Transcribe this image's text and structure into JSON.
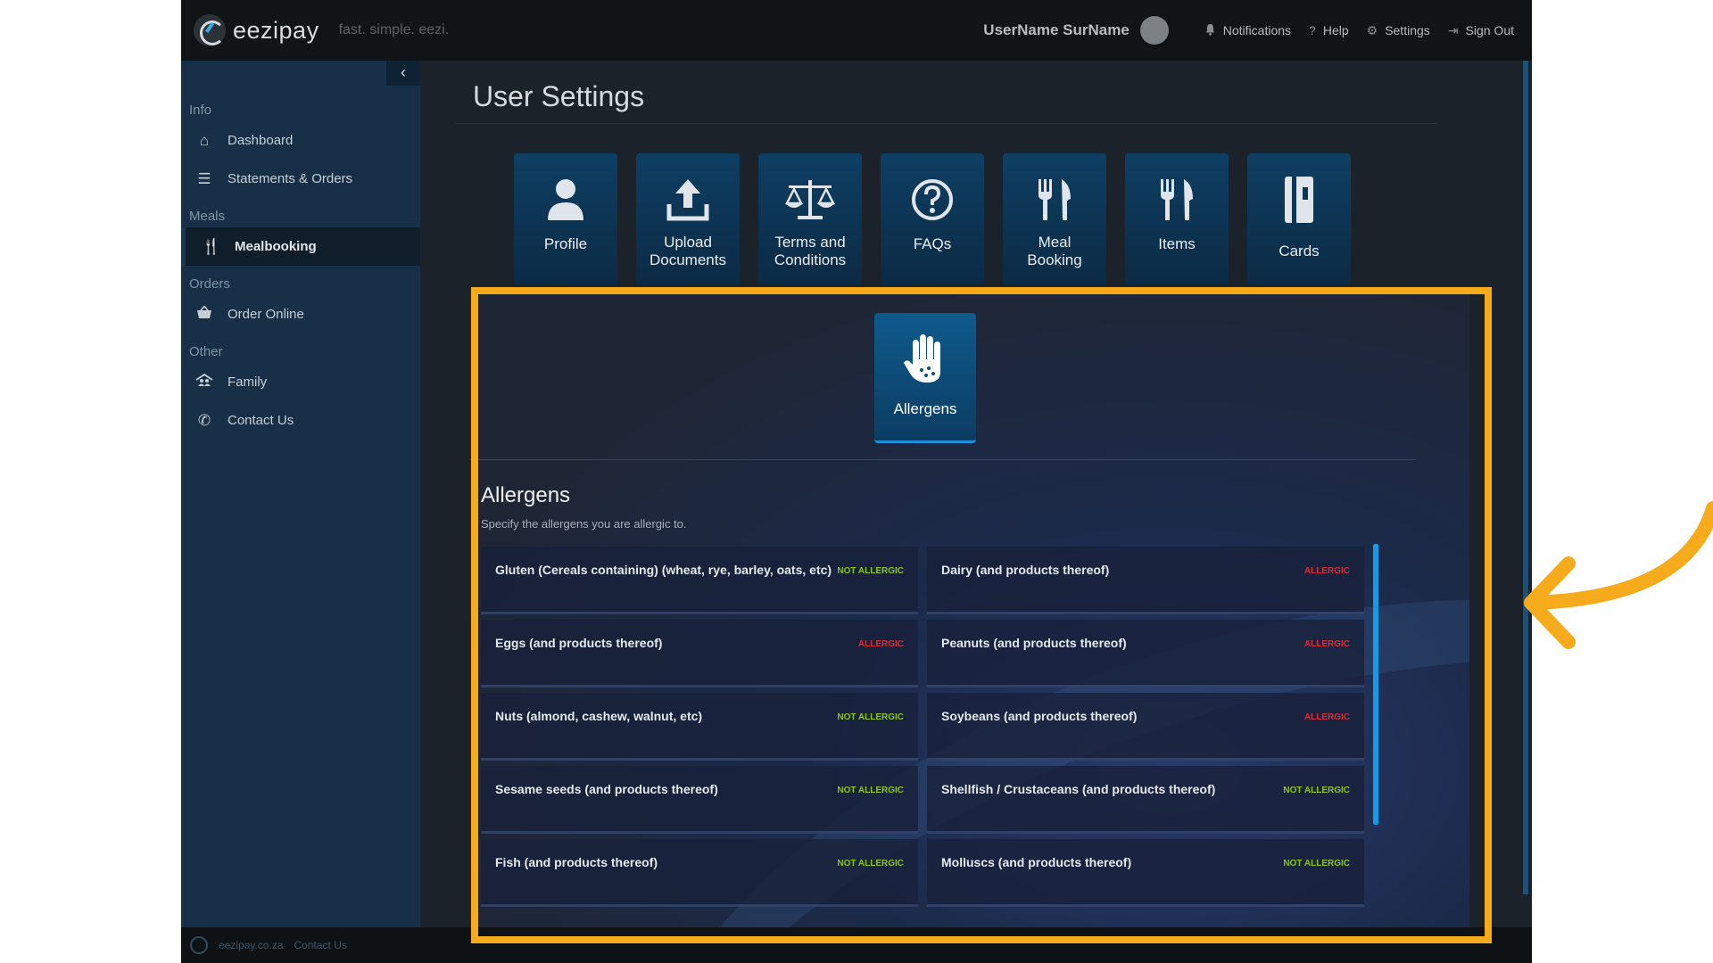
{
  "header": {
    "logo_text": "eezipay",
    "tagline": "fast. simple. eezi.",
    "username": "UserName SurName",
    "nav": [
      {
        "label": "Notifications",
        "icon": "bell-icon"
      },
      {
        "label": "Help",
        "icon": "question-icon"
      },
      {
        "label": "Settings",
        "icon": "gear-icon"
      },
      {
        "label": "Sign Out",
        "icon": "sign-out-icon"
      }
    ]
  },
  "sidebar": {
    "collapse_glyph": "‹",
    "sections": [
      {
        "title": "Info",
        "items": [
          {
            "label": "Dashboard",
            "icon": "home-icon"
          },
          {
            "label": "Statements & Orders",
            "icon": "list-icon"
          }
        ]
      },
      {
        "title": "Meals",
        "items": [
          {
            "label": "Mealbooking",
            "icon": "cutlery-icon",
            "active": true
          }
        ]
      },
      {
        "title": "Orders",
        "items": [
          {
            "label": "Order Online",
            "icon": "basket-icon"
          }
        ]
      },
      {
        "title": "Other",
        "items": [
          {
            "label": "Family",
            "icon": "family-icon"
          },
          {
            "label": "Contact Us",
            "icon": "phone-icon"
          }
        ]
      }
    ]
  },
  "footer": {
    "site": "eezipay.co.za",
    "contact": "Contact Us"
  },
  "main": {
    "page_title": "User Settings",
    "tiles": [
      {
        "line1": "Profile",
        "line2": "",
        "icon": "user-icon"
      },
      {
        "line1": "Upload",
        "line2": "Documents",
        "icon": "upload-icon"
      },
      {
        "line1": "Terms and",
        "line2": "Conditions",
        "icon": "scale-icon"
      },
      {
        "line1": "FAQs",
        "line2": "",
        "icon": "question-circle-icon"
      },
      {
        "line1": "Meal",
        "line2": "Booking",
        "icon": "cutlery-icon"
      },
      {
        "line1": "Items",
        "line2": "",
        "icon": "cutlery-icon"
      },
      {
        "line1": "Cards",
        "line2": "",
        "icon": "card-icon"
      }
    ],
    "allergen_tile": {
      "label": "Allergens",
      "icon": "hand-icon"
    },
    "allergens_section": {
      "title": "Allergens",
      "subtitle": "Specify the allergens you are allergic to.",
      "items": [
        {
          "name": "Gluten (Cereals containing) (wheat, rye, barley, oats, etc)",
          "status": "NOT ALLERGIC",
          "allergic": false
        },
        {
          "name": "Dairy (and products thereof)",
          "status": "ALLERGIC",
          "allergic": true
        },
        {
          "name": "Eggs (and products thereof)",
          "status": "ALLERGIC",
          "allergic": true
        },
        {
          "name": "Peanuts (and products thereof)",
          "status": "ALLERGIC",
          "allergic": true
        },
        {
          "name": "Nuts (almond, cashew, walnut, etc)",
          "status": "NOT ALLERGIC",
          "allergic": false
        },
        {
          "name": "Soybeans (and products thereof)",
          "status": "ALLERGIC",
          "allergic": true
        },
        {
          "name": "Sesame seeds (and products thereof)",
          "status": "NOT ALLERGIC",
          "allergic": false
        },
        {
          "name": "Shellfish / Crustaceans (and products thereof)",
          "status": "NOT ALLERGIC",
          "allergic": false
        },
        {
          "name": "Fish (and products thereof)",
          "status": "NOT ALLERGIC",
          "allergic": false
        },
        {
          "name": "Molluscs (and products thereof)",
          "status": "NOT ALLERGIC",
          "allergic": false
        }
      ]
    }
  },
  "colors": {
    "accent": "#f6ab1d",
    "not_allergic": "#8dc21f",
    "allergic": "#d2303b",
    "tile": "#0e3f63"
  }
}
